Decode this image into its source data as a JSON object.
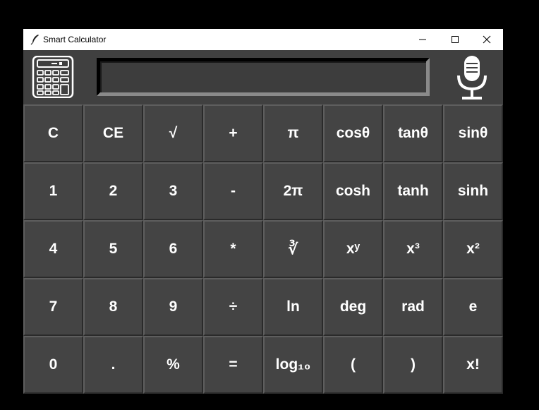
{
  "window": {
    "title": "Smart Calculator"
  },
  "display": {
    "value": ""
  },
  "keys": [
    [
      "C",
      "CE",
      "√",
      "+",
      "π",
      "cosθ",
      "tanθ",
      "sinθ"
    ],
    [
      "1",
      "2",
      "3",
      "-",
      "2π",
      "cosh",
      "tanh",
      "sinh"
    ],
    [
      "4",
      "5",
      "6",
      "*",
      "∛",
      "xʸ",
      "x³",
      "x²"
    ],
    [
      "7",
      "8",
      "9",
      "÷",
      "ln",
      "deg",
      "rad",
      "e"
    ],
    [
      "0",
      ".",
      "%",
      "=",
      "log₁₀",
      "(",
      ")",
      "x!"
    ]
  ],
  "icons": {
    "app": "feather-icon",
    "calculator": "calculator-icon",
    "microphone": "microphone-icon"
  },
  "colors": {
    "background": "#3a3a3a",
    "key": "#444444",
    "text": "#ffffff"
  }
}
